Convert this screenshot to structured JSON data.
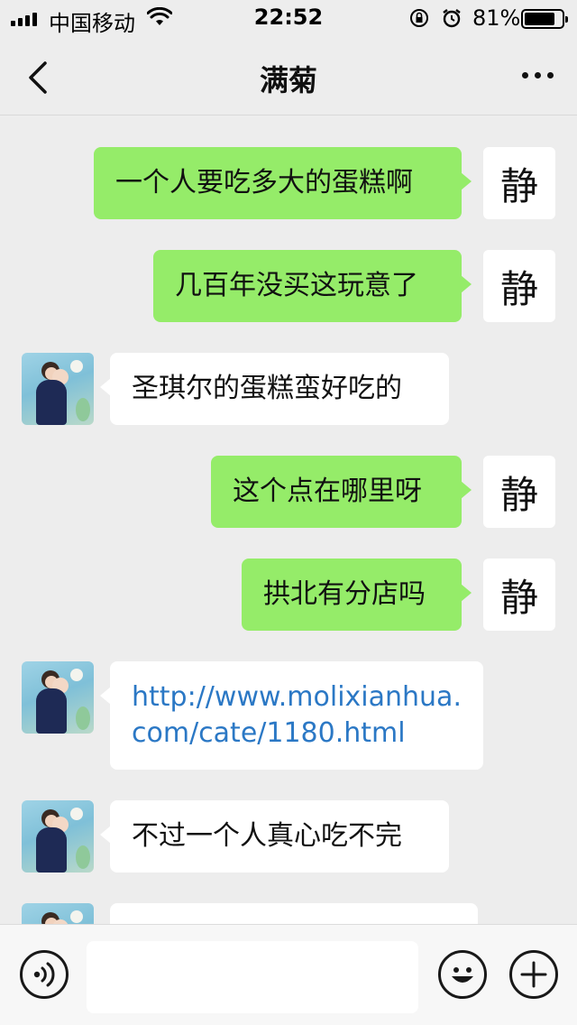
{
  "status_bar": {
    "carrier": "中国移动",
    "time": "22:52",
    "battery_percent": "81%",
    "battery_level": 0.81,
    "icons": [
      "signal-icon",
      "wifi-icon",
      "orientation-lock-icon",
      "alarm-icon",
      "battery-icon"
    ]
  },
  "nav": {
    "title": "满菊",
    "back_icon": "chevron-left-icon",
    "more_icon": "more-dots-icon"
  },
  "me": {
    "avatar_text": "静"
  },
  "messages": [
    {
      "sender": "me",
      "text": "一个人要吃多大的蛋糕啊"
    },
    {
      "sender": "me",
      "text": "几百年没买这玩意了"
    },
    {
      "sender": "other",
      "text": "圣琪尔的蛋糕蛮好吃的"
    },
    {
      "sender": "me",
      "text": "这个点在哪里呀"
    },
    {
      "sender": "me",
      "text": "拱北有分店吗"
    },
    {
      "sender": "other",
      "text": "http://www.molixianhua.com/cate/1180.html",
      "is_link": true
    },
    {
      "sender": "other",
      "text": "不过一个人真心吃不完"
    },
    {
      "sender": "other",
      "text": ""
    }
  ],
  "input_bar": {
    "input_value": "",
    "voice_icon": "voice-icon",
    "emoji_icon": "emoji-icon",
    "plus_icon": "plus-icon"
  }
}
